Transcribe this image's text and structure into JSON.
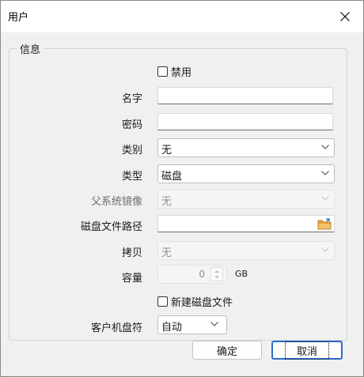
{
  "window": {
    "title": "用户"
  },
  "group": {
    "title": "信息"
  },
  "form": {
    "disable_label": "禁用",
    "name_label": "名字",
    "name_value": "",
    "password_label": "密码",
    "password_value": "",
    "category_label": "类别",
    "category_value": "无",
    "type_label": "类型",
    "type_value": "磁盘",
    "parent_image_label": "父系统镜像",
    "parent_image_value": "无",
    "disk_path_label": "磁盘文件路径",
    "disk_path_value": "",
    "copy_label": "拷贝",
    "copy_value": "无",
    "capacity_label": "容量",
    "capacity_value": "0",
    "capacity_unit": "GB",
    "new_disk_label": "新建磁盘文件",
    "client_drive_label": "客户机盘符",
    "client_drive_value": "自动"
  },
  "buttons": {
    "ok": "确定",
    "cancel": "取消"
  },
  "colors": {
    "accent": "#2a6bc8",
    "folder": "#e8a23a"
  }
}
